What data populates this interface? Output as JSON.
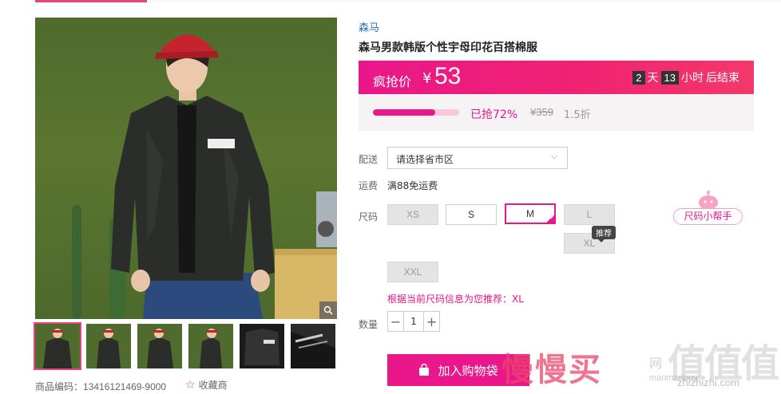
{
  "product": {
    "brand": "森马",
    "title": "森马男款韩版个性宇母印花百搭棉服",
    "item_code": "商品编码：13416121469-9000",
    "favorite_label": "收藏商"
  },
  "price": {
    "label": "疯抢价",
    "currency": "¥",
    "value": "53",
    "countdown": {
      "days": "2",
      "days_unit": "天",
      "hours": "13",
      "hours_unit": "小时",
      "suffix": "后结束"
    }
  },
  "progress": {
    "sold_fraction": 0.72,
    "sold_text": "已抢72%",
    "original_price": "¥359",
    "discount": "1.5折"
  },
  "delivery": {
    "label": "配送",
    "placeholder": "请选择省市区"
  },
  "shipping": {
    "label": "运费",
    "text": "满88免运费"
  },
  "size": {
    "label": "尺码",
    "options": [
      {
        "label": "XS",
        "state": "disabled"
      },
      {
        "label": "S",
        "state": "available"
      },
      {
        "label": "M",
        "state": "selected"
      },
      {
        "label": "L",
        "state": "disabled"
      },
      {
        "label": "XL",
        "state": "disabled"
      },
      {
        "label": "XXL",
        "state": "disabled"
      }
    ],
    "recommend_badge": "推荐",
    "helper_label": "尺码小帮手",
    "recommendation_text": "根据当前尺码信息为您推荐：XL"
  },
  "quantity": {
    "label": "数量",
    "value": "1",
    "minus": "−",
    "plus": "+"
  },
  "cart": {
    "label": "加入购物袋"
  },
  "watermark": {
    "main": "慢慢买",
    "site_text": "网",
    "domain1": "manmanbuy",
    "big": "值值值",
    "domain2": "zhizhizhi.com"
  },
  "colors": {
    "accent": "#e9178a",
    "link": "#2a6ebb"
  },
  "icons": [
    "zoom-icon",
    "star-icon",
    "bag-icon",
    "chevron-down-icon",
    "check-icon",
    "mascot-icon"
  ]
}
